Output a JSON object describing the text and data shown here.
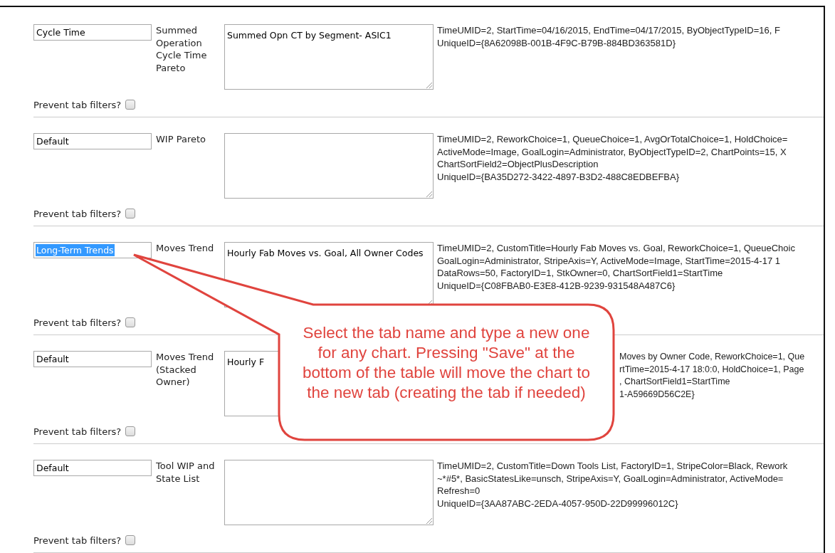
{
  "rows": [
    {
      "tab_name": "Cycle Time",
      "tab_name_highlighted": false,
      "chart_name": "Summed Operation Cycle Time Pareto",
      "description": "Summed Opn CT by Segment- ASIC1",
      "covered": false,
      "params": [
        "TimeUMID=2, StartTime=04/16/2015, EndTime=04/17/2015, ByObjectTypeID=16, F",
        "UniqueID={8A62098B-001B-4F9C-B79B-884BD363581D}"
      ],
      "prevent_label": "Prevent tab filters?",
      "prevent_checked": false
    },
    {
      "tab_name": "Default",
      "tab_name_highlighted": false,
      "chart_name": "WIP Pareto",
      "description": "",
      "covered": false,
      "params": [
        "TimeUMID=2, ReworkChoice=1, QueueChoice=1, AvgOrTotalChoice=1, HoldChoice=",
        "ActiveMode=Image, GoalLogin=Administrator, ByObjectTypeID=2, ChartPoints=15, X",
        "ChartSortField2=ObjectPlusDescription",
        "UniqueID={BA35D272-3422-4897-B3D2-488C8EDBEFBA}"
      ],
      "prevent_label": "Prevent tab filters?",
      "prevent_checked": false
    },
    {
      "tab_name": "Long-Term Trends",
      "tab_name_highlighted": true,
      "chart_name": "Moves Trend",
      "description": "Hourly Fab Moves vs. Goal, All Owner Codes",
      "covered": false,
      "params": [
        "TimeUMID=2, CustomTitle=Hourly Fab Moves vs. Goal, ReworkChoice=1, QueueChoic",
        "GoalLogin=Administrator, StripeAxis=Y, ActiveMode=Image, StartTime=2015-4-17 1",
        "DataRows=50, FactoryID=1, StkOwner=0, ChartSortField1=StartTime",
        "UniqueID={C08FBAB0-E3E8-412B-9239-931548A487C6}"
      ],
      "prevent_label": "Prevent tab filters?",
      "prevent_checked": false
    },
    {
      "tab_name": "Default",
      "tab_name_highlighted": false,
      "chart_name": "Moves Trend (Stacked Owner)",
      "description": "Hourly F",
      "covered": true,
      "params": [
        "Moves by Owner Code, ReworkChoice=1, Que",
        "rtTime=2015-4-17 18:0:0, HoldChoice=1, Page",
        ", ChartSortField1=StartTime",
        "1-A59669D56C2E}"
      ],
      "prevent_label": "Prevent tab filters?",
      "prevent_checked": false
    },
    {
      "tab_name": "Default",
      "tab_name_highlighted": false,
      "chart_name": "Tool WIP and State List",
      "description": "",
      "covered": false,
      "params": [
        "TimeUMID=2, CustomTitle=Down Tools List, FactoryID=1, StripeColor=Black, Rework",
        "~*#5*, BasicStatesLike=unsch, StripeAxis=Y, GoalLogin=Administrator, ActiveMode=",
        "Refresh=0",
        "UniqueID={3AA87ABC-2EDA-4057-950D-22D99996012C}"
      ],
      "prevent_label": "Prevent tab filters?",
      "prevent_checked": false
    }
  ],
  "callout": {
    "text": "Select the tab name and type a new one for any chart. Pressing \"Save\" at the bottom of the table will move the chart to the new tab (creating the tab if needed)"
  }
}
